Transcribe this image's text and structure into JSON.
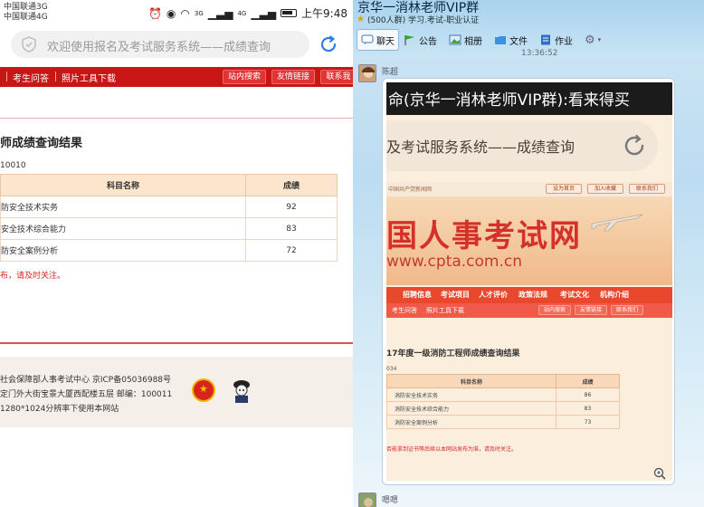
{
  "phone": {
    "status": {
      "carrier1": "中国联通3G",
      "carrier2": "中国联通4G",
      "signal1": "3G",
      "signal2": "4G",
      "time": "上午9:48"
    },
    "url_placeholder": "欢迎使用报名及考试服务系统——成绩查询",
    "nav": {
      "links": [
        "考生问答",
        "照片工具下载"
      ],
      "buttons": [
        "站内搜索",
        "友情链接",
        "联系我"
      ]
    },
    "result_title": "师成绩查询结果",
    "candidate_id": "10010",
    "table": {
      "headers": [
        "科目名称",
        "成绩"
      ],
      "rows": [
        {
          "name": "防安全技术实务",
          "score": "92"
        },
        {
          "name": "安全技术综合能力",
          "score": "83"
        },
        {
          "name": "防安全案例分析",
          "score": "72"
        }
      ]
    },
    "note": "布，请及时关注。",
    "footer": {
      "line1": "社会保障部人事考试中心 京ICP备05036988号",
      "line2": "定门外大街宝景大厦西配楼五层 邮编：100011",
      "line3": "1280*1024分辨率下使用本网站"
    }
  },
  "qq": {
    "group_name": "京华一消林老师VIP群",
    "group_info": "(500人群) 学习.考试-职业认证",
    "tabs": [
      "聊天",
      "公告",
      "相册",
      "文件",
      "作业"
    ],
    "time": "13:36:52",
    "sender1": "陈超",
    "sender2": "嗯嗯",
    "shot": {
      "black_text": "命(京华一消林老师VIP群):看来得买",
      "url_text": "及考试服务系统——成绩查询",
      "top_text": "中国共产党新闻网",
      "top_buttons": [
        "设为首页",
        "加入收藏",
        "联系我们"
      ],
      "banner_title": "国人事考试网",
      "banner_url": "www.cpta.com.cn",
      "menu": [
        "招聘信息",
        "考试项目",
        "人才评价",
        "政策法规",
        "考试文化",
        "机构介绍"
      ],
      "menu2_links": [
        "考生问答",
        "照片工具下载"
      ],
      "menu2_buttons": [
        "站内搜索",
        "友情链接",
        "联系我们"
      ],
      "result_title": "17年度一级消防工程师成绩查询结果",
      "candidate_id": "034",
      "table": {
        "headers": [
          "科目名称",
          "成绩"
        ],
        "rows": [
          {
            "name": "消防安全技术实务",
            "score": "86"
          },
          {
            "name": "消防安全技术综合能力",
            "score": "83"
          },
          {
            "name": "消防安全案例分析",
            "score": "73"
          }
        ]
      },
      "note": "否能拿到证书等后续以本网站发布为准，请及时关注。"
    }
  },
  "colors": {
    "nav_red": "#c81616",
    "qq_blue": "#bcdcf1",
    "note_red": "#dd2222"
  }
}
